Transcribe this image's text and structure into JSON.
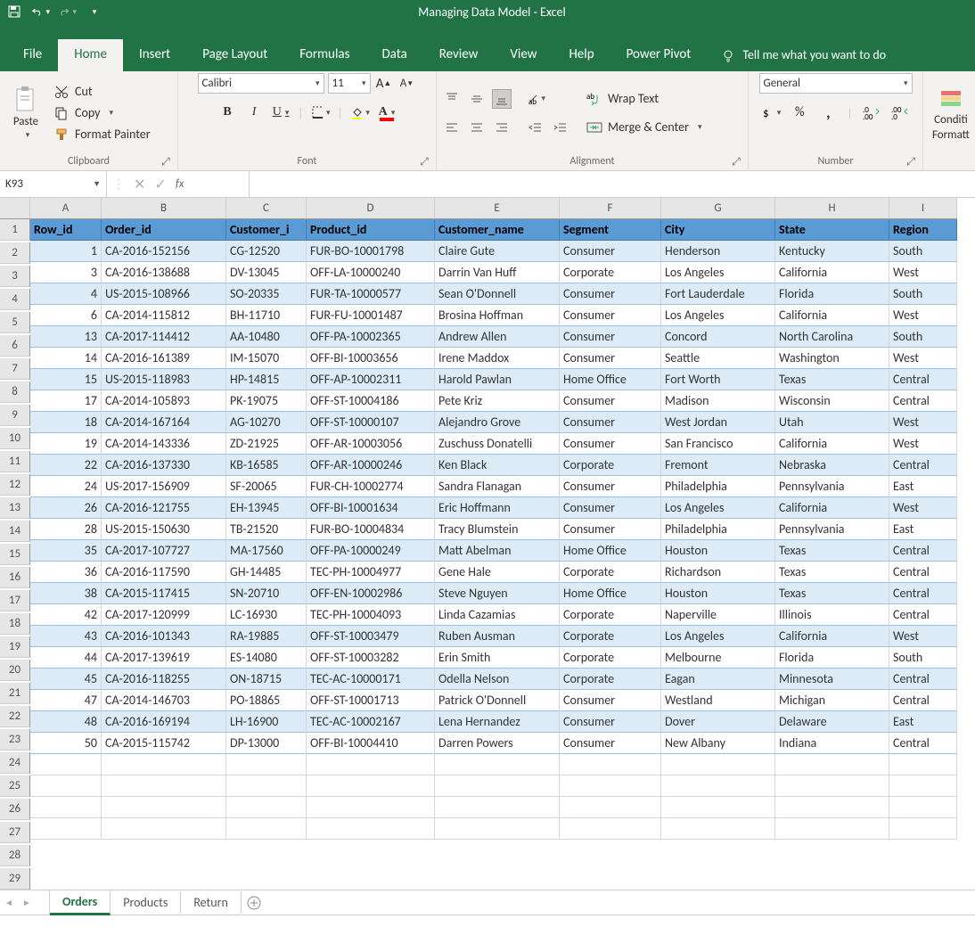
{
  "window": {
    "title": "Managing Data Model  -  Excel"
  },
  "namebox": "K93",
  "ribbon_tabs": {
    "file": "File",
    "home": "Home",
    "insert": "Insert",
    "page": "Page Layout",
    "formulas": "Formulas",
    "data": "Data",
    "review": "Review",
    "view": "View",
    "help": "Help",
    "power": "Power Pivot",
    "tellme": "Tell me what you want to do"
  },
  "clipboard": {
    "paste": "Paste",
    "cut": "Cut",
    "copy": "Copy",
    "fp": "Format Painter",
    "label": "Clipboard"
  },
  "font": {
    "name": "Calibri",
    "size": "11",
    "label": "Font"
  },
  "alignment": {
    "wrap": "Wrap Text",
    "merge": "Merge & Center",
    "label": "Alignment"
  },
  "number": {
    "format": "General",
    "label": "Number"
  },
  "cond": {
    "l1": "Conditi",
    "l2": "Formatt"
  },
  "columns": [
    "A",
    "B",
    "C",
    "D",
    "E",
    "F",
    "G",
    "H",
    "I"
  ],
  "headers": [
    "Row_id",
    "Order_id",
    "Customer_i",
    "Product_id",
    "Customer_name",
    "Segment",
    "City",
    "State",
    "Region"
  ],
  "rows": [
    [
      "1",
      "CA-2016-152156",
      "CG-12520",
      "FUR-BO-10001798",
      "Claire Gute",
      "Consumer",
      "Henderson",
      "Kentucky",
      "South"
    ],
    [
      "3",
      "CA-2016-138688",
      "DV-13045",
      "OFF-LA-10000240",
      "Darrin Van Huff",
      "Corporate",
      "Los Angeles",
      "California",
      "West"
    ],
    [
      "4",
      "US-2015-108966",
      "SO-20335",
      "FUR-TA-10000577",
      "Sean O'Donnell",
      "Consumer",
      "Fort Lauderdale",
      "Florida",
      "South"
    ],
    [
      "6",
      "CA-2014-115812",
      "BH-11710",
      "FUR-FU-10001487",
      "Brosina Hoffman",
      "Consumer",
      "Los Angeles",
      "California",
      "West"
    ],
    [
      "13",
      "CA-2017-114412",
      "AA-10480",
      "OFF-PA-10002365",
      "Andrew Allen",
      "Consumer",
      "Concord",
      "North Carolina",
      "South"
    ],
    [
      "14",
      "CA-2016-161389",
      "IM-15070",
      "OFF-BI-10003656",
      "Irene Maddox",
      "Consumer",
      "Seattle",
      "Washington",
      "West"
    ],
    [
      "15",
      "US-2015-118983",
      "HP-14815",
      "OFF-AP-10002311",
      "Harold Pawlan",
      "Home Office",
      "Fort Worth",
      "Texas",
      "Central"
    ],
    [
      "17",
      "CA-2014-105893",
      "PK-19075",
      "OFF-ST-10004186",
      "Pete Kriz",
      "Consumer",
      "Madison",
      "Wisconsin",
      "Central"
    ],
    [
      "18",
      "CA-2014-167164",
      "AG-10270",
      "OFF-ST-10000107",
      "Alejandro Grove",
      "Consumer",
      "West Jordan",
      "Utah",
      "West"
    ],
    [
      "19",
      "CA-2014-143336",
      "ZD-21925",
      "OFF-AR-10003056",
      "Zuschuss Donatelli",
      "Consumer",
      "San Francisco",
      "California",
      "West"
    ],
    [
      "22",
      "CA-2016-137330",
      "KB-16585",
      "OFF-AR-10000246",
      "Ken Black",
      "Corporate",
      "Fremont",
      "Nebraska",
      "Central"
    ],
    [
      "24",
      "US-2017-156909",
      "SF-20065",
      "FUR-CH-10002774",
      "Sandra Flanagan",
      "Consumer",
      "Philadelphia",
      "Pennsylvania",
      "East"
    ],
    [
      "26",
      "CA-2016-121755",
      "EH-13945",
      "OFF-BI-10001634",
      "Eric Hoffmann",
      "Consumer",
      "Los Angeles",
      "California",
      "West"
    ],
    [
      "28",
      "US-2015-150630",
      "TB-21520",
      "FUR-BO-10004834",
      "Tracy Blumstein",
      "Consumer",
      "Philadelphia",
      "Pennsylvania",
      "East"
    ],
    [
      "35",
      "CA-2017-107727",
      "MA-17560",
      "OFF-PA-10000249",
      "Matt Abelman",
      "Home Office",
      "Houston",
      "Texas",
      "Central"
    ],
    [
      "36",
      "CA-2016-117590",
      "GH-14485",
      "TEC-PH-10004977",
      "Gene Hale",
      "Corporate",
      "Richardson",
      "Texas",
      "Central"
    ],
    [
      "38",
      "CA-2015-117415",
      "SN-20710",
      "OFF-EN-10002986",
      "Steve Nguyen",
      "Home Office",
      "Houston",
      "Texas",
      "Central"
    ],
    [
      "42",
      "CA-2017-120999",
      "LC-16930",
      "TEC-PH-10004093",
      "Linda Cazamias",
      "Corporate",
      "Naperville",
      "Illinois",
      "Central"
    ],
    [
      "43",
      "CA-2016-101343",
      "RA-19885",
      "OFF-ST-10003479",
      "Ruben Ausman",
      "Corporate",
      "Los Angeles",
      "California",
      "West"
    ],
    [
      "44",
      "CA-2017-139619",
      "ES-14080",
      "OFF-ST-10003282",
      "Erin Smith",
      "Corporate",
      "Melbourne",
      "Florida",
      "South"
    ],
    [
      "45",
      "CA-2016-118255",
      "ON-18715",
      "TEC-AC-10000171",
      "Odella Nelson",
      "Corporate",
      "Eagan",
      "Minnesota",
      "Central"
    ],
    [
      "47",
      "CA-2014-146703",
      "PO-18865",
      "OFF-ST-10001713",
      "Patrick O'Donnell",
      "Consumer",
      "Westland",
      "Michigan",
      "Central"
    ],
    [
      "48",
      "CA-2016-169194",
      "LH-16900",
      "TEC-AC-10002167",
      "Lena Hernandez",
      "Consumer",
      "Dover",
      "Delaware",
      "East"
    ],
    [
      "50",
      "CA-2015-115742",
      "DP-13000",
      "OFF-BI-10004410",
      "Darren Powers",
      "Consumer",
      "New Albany",
      "Indiana",
      "Central"
    ]
  ],
  "sheets": {
    "s1": "Orders",
    "s2": "Products",
    "s3": "Return"
  }
}
